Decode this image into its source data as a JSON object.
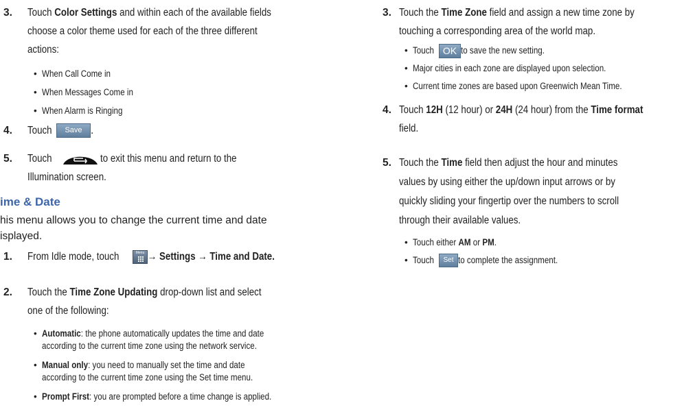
{
  "left": {
    "step3": {
      "number": "3.",
      "line1_pre": "Touch ",
      "line1_bold": "Color Settings",
      "line1_post": " and within each of the available fields",
      "line2": "choose a color theme used for each of the three different",
      "line3": "actions:"
    },
    "bullets": [
      "When Call Come in",
      "When Messages Come in",
      "When Alarm is Ringing"
    ],
    "step4": {
      "number": "4.",
      "text": "Touch ",
      "button": "Save",
      "tail": "."
    },
    "step5": {
      "number": "5.",
      "text_pre": "Touch ",
      "text_post": " to exit this menu and return to the",
      "line2": "Illumination screen."
    },
    "heading": "ime & Date",
    "intro_line1": "his menu allows you to change the current time and date",
    "intro_line2": "isplayed.",
    "td_step1": {
      "number": "1.",
      "pre": "From Idle mode, touch ",
      "menu_icon_label": "Menu",
      "post": " → Settings → Time and Date."
    },
    "td_step2": {
      "number": "2.",
      "pre": "Touch the ",
      "bold": "Time Zone Updating",
      "post": " drop-down list and select",
      "line2": "one of the following:"
    },
    "options": [
      {
        "term": "Automatic",
        "line1": ": the phone automatically updates the time and date",
        "line2": "according to the current time zone using the network service."
      },
      {
        "term": "Manual only",
        "line1": ": you need to manually set the time and date",
        "line2": "according to the current time zone using the Set time menu."
      },
      {
        "term": "Prompt First",
        "line1": ": you are prompted before a time change is applied.",
        "line2": ""
      }
    ]
  },
  "right": {
    "step3": {
      "number": "3.",
      "pre": "Touch the ",
      "bold": "Time Zone",
      "post": " field and assign a new time zone by",
      "line2": "touching a corresponding area of the world map."
    },
    "step3_bullets": {
      "ok_pre": "Touch ",
      "ok_button": "OK",
      "ok_post": " to save the new setting.",
      "b2": "Major cities in each zone are displayed upon selection.",
      "b3": "Current time zones are based upon Greenwich Mean Time."
    },
    "step4": {
      "number": "4.",
      "pre": "Touch ",
      "b1": "12H",
      "m1": " (12 hour) or ",
      "b2": "24H",
      "m2": " (24 hour) from the ",
      "b3": "Time format",
      "line2": "field."
    },
    "step5": {
      "number": "5.",
      "pre": "Touch the ",
      "bold": "Time",
      "post": " field then adjust the hour and minutes",
      "line2": "values by using either the up/down input arrows or by",
      "line3": "quickly sliding your fingertip over the numbers to scroll",
      "line4": "through their available values."
    },
    "step5_bullets": {
      "ampm_pre": "Touch either ",
      "am": "AM",
      "or": " or ",
      "pm": "PM",
      "dot": ".",
      "set_pre": "Touch ",
      "set_button": "Set",
      "set_post": " to complete the assignment."
    }
  }
}
